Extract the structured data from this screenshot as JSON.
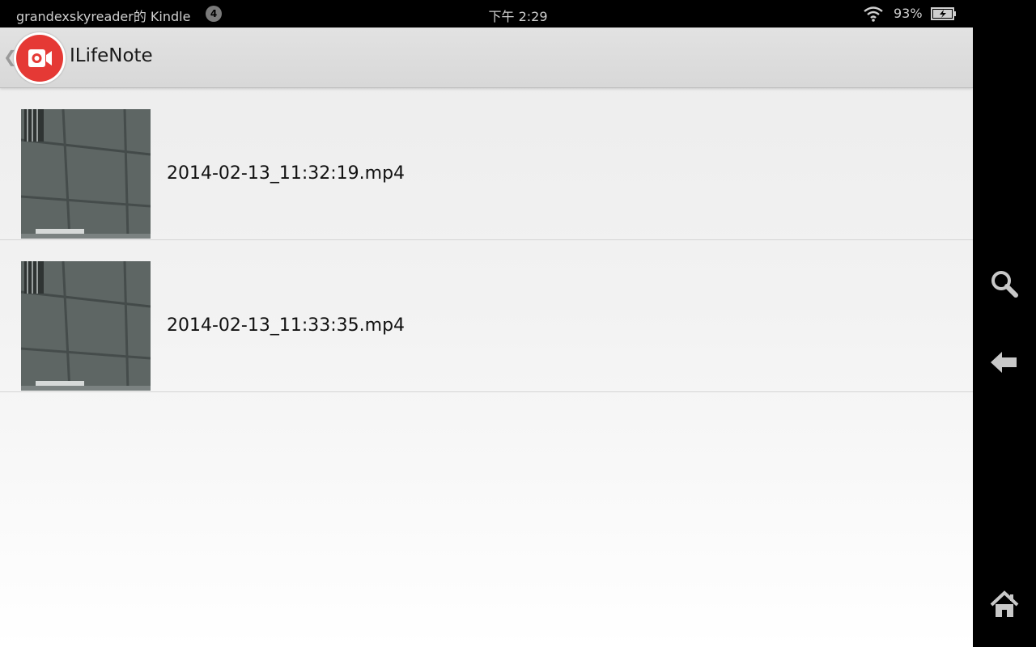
{
  "status_bar": {
    "device_name": "grandexskyreader的 Kindle",
    "notification_count": "4",
    "time": "下午 2:29",
    "battery_percent": "93%"
  },
  "action_bar": {
    "title": "ILifeNote",
    "icon": "video-camera-icon",
    "accent_color": "#e53935"
  },
  "files": [
    {
      "name": "2014-02-13_11:32:19.mp4",
      "thumbnail": "ceiling-video-thumbnail"
    },
    {
      "name": "2014-02-13_11:33:35.mp4",
      "thumbnail": "ceiling-video-thumbnail"
    }
  ],
  "nav_bar": {
    "buttons": [
      "search-icon",
      "back-arrow-icon",
      "home-icon"
    ]
  }
}
